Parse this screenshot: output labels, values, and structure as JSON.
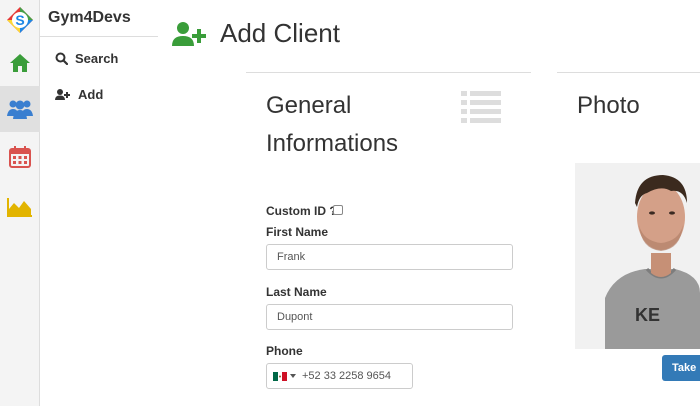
{
  "app": {
    "name": "Gym4Devs"
  },
  "rail": {
    "items": [
      {
        "icon": "home-icon"
      },
      {
        "icon": "users-icon",
        "active": true
      },
      {
        "icon": "calendar-icon"
      },
      {
        "icon": "area-chart-icon"
      }
    ]
  },
  "submenu": {
    "search_label": "Search",
    "add_label": "Add"
  },
  "page": {
    "title": "Add Client"
  },
  "general": {
    "title": "General Informations",
    "custom_id_label": "Custom ID ?",
    "first_name_label": "First Name",
    "first_name_value": "Frank",
    "last_name_label": "Last Name",
    "last_name_value": "Dupont",
    "phone_label": "Phone",
    "phone_value": "+52 33 2258 9654"
  },
  "photo": {
    "title": "Photo",
    "take_button_label": "Take p"
  },
  "colors": {
    "green": "#3a9d3a",
    "blue": "#3a7fd0",
    "red": "#d9534f",
    "yellow": "#e2b400",
    "primary": "#337ab7"
  }
}
